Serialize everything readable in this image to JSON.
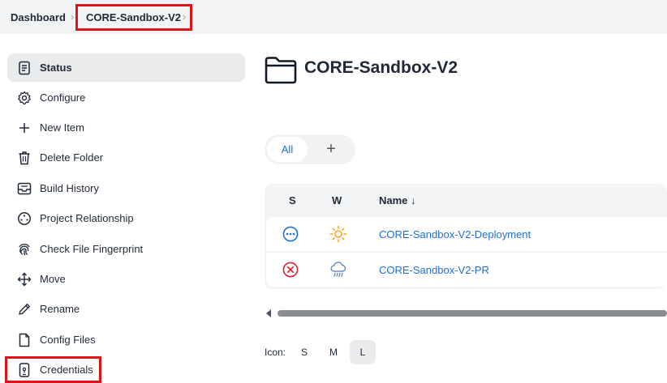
{
  "breadcrumb": {
    "items": [
      "Dashboard",
      "CORE-Sandbox-V2"
    ],
    "separator": "›"
  },
  "sidebar": {
    "items": [
      {
        "label": "Status",
        "icon": "document-icon",
        "active": true
      },
      {
        "label": "Configure",
        "icon": "gear-icon"
      },
      {
        "label": "New Item",
        "icon": "plus-icon"
      },
      {
        "label": "Delete Folder",
        "icon": "trash-icon"
      },
      {
        "label": "Build History",
        "icon": "inbox-icon"
      },
      {
        "label": "Project Relationship",
        "icon": "relationship-icon"
      },
      {
        "label": "Check File Fingerprint",
        "icon": "fingerprint-icon"
      },
      {
        "label": "Move",
        "icon": "move-icon"
      },
      {
        "label": "Rename",
        "icon": "pencil-icon"
      },
      {
        "label": "Config Files",
        "icon": "file-icon"
      },
      {
        "label": "Credentials",
        "icon": "phone-key-icon"
      }
    ]
  },
  "main": {
    "title": "CORE-Sandbox-V2",
    "title_icon": "folder-icon",
    "tabs": [
      {
        "label": "All",
        "active": true
      },
      {
        "label": "+"
      }
    ],
    "table": {
      "headers": {
        "s": "S",
        "w": "W",
        "name": "Name ↓"
      },
      "rows": [
        {
          "status": "in-progress",
          "status_icon": "ellipsis-circle-icon",
          "weather": "sunny-icon",
          "name": "CORE-Sandbox-V2-Deployment"
        },
        {
          "status": "failed",
          "status_icon": "error-x-icon",
          "weather": "rain-cloud-icon",
          "name": "CORE-Sandbox-V2-PR"
        }
      ]
    },
    "icon_size": {
      "label": "Icon:",
      "options": [
        "S",
        "M",
        "L"
      ],
      "selected": "L"
    }
  },
  "colors": {
    "highlight": "#e0121b",
    "link": "#1d6fd6",
    "status_running": "#1d6fd6",
    "status_failed": "#d5232f",
    "sun": "#f5a623",
    "rain_cloud": "#6b8fb8"
  }
}
